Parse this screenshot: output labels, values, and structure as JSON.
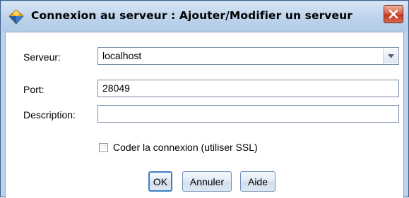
{
  "window": {
    "title": "Connexion au serveur : Ajouter/Modifier un serveur",
    "app_icon": "diamond-icon",
    "close_icon": "close-icon"
  },
  "form": {
    "server_label": "Serveur:",
    "server_value": "localhost",
    "port_label": "Port:",
    "port_value": "28049",
    "description_label": "Description:",
    "description_value": "",
    "ssl_checkbox_label": "Coder la connexion (utiliser SSL)",
    "ssl_checked": false
  },
  "buttons": {
    "ok": "OK",
    "cancel": "Annuler",
    "help": "Aide"
  },
  "colors": {
    "frame": "#bcd3ec",
    "close_button": "#c4391f",
    "icon_diamond": "#f0a81e",
    "icon_diamond_dark": "#2a5aa8",
    "default_button_border": "#3c7fc9"
  }
}
